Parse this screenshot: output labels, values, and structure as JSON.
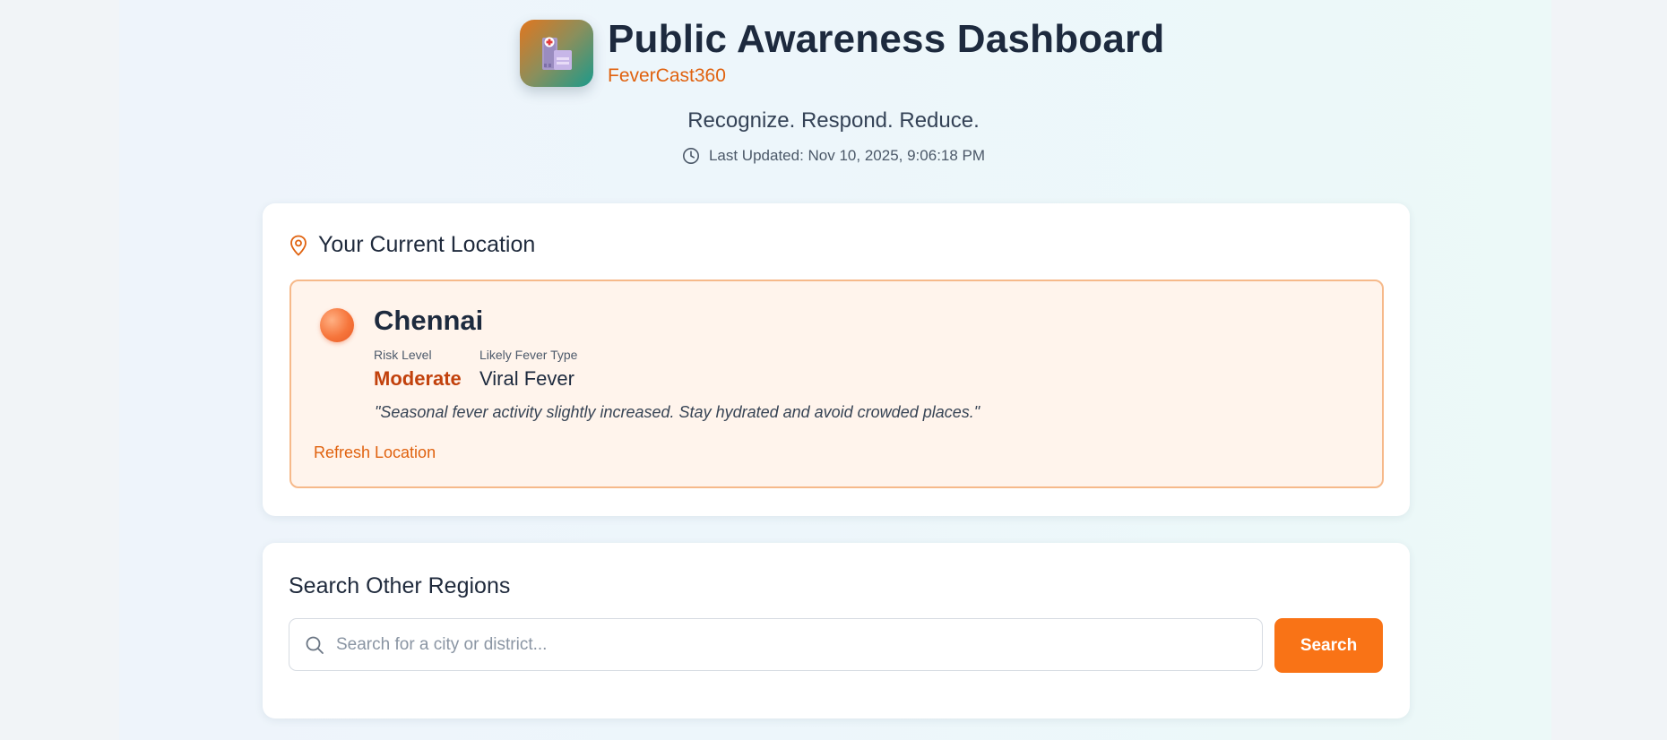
{
  "header": {
    "title": "Public Awareness Dashboard",
    "brand": "FeverCast360",
    "logo_icon": "hospital-icon",
    "tagline": "Recognize. Respond. Reduce.",
    "last_updated": "Last Updated: Nov 10, 2025, 9:06:18 PM"
  },
  "location_card": {
    "heading": "Your Current Location",
    "city": "Chennai",
    "risk_label": "Risk Level",
    "risk_value": "Moderate",
    "fever_label": "Likely Fever Type",
    "fever_value": "Viral Fever",
    "advice": "\"Seasonal fever activity slightly increased. Stay hydrated and avoid crowded places.\"",
    "refresh_label": "Refresh Location"
  },
  "search_card": {
    "heading": "Search Other Regions",
    "placeholder": "Search for a city or district...",
    "value": "",
    "button_label": "Search"
  },
  "colors": {
    "accent": "#f97316",
    "brand": "#e0620f",
    "risk_moderate": "#c2410c",
    "location_box_bg": "#fff4ec",
    "location_box_border": "#f6b98a"
  }
}
